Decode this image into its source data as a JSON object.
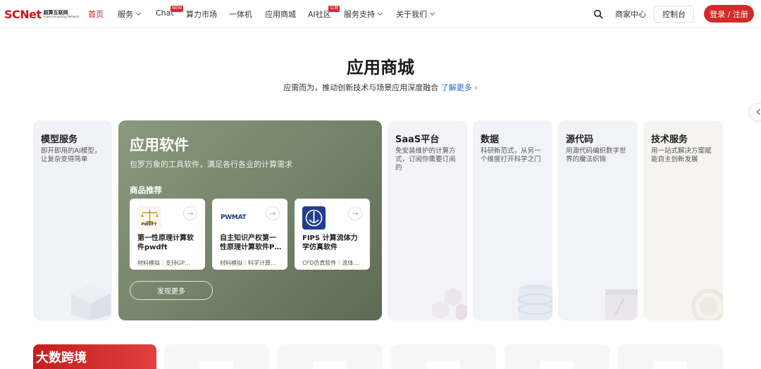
{
  "nav": {
    "logo_main": "SCNet",
    "logo_cn": "超算互联网",
    "logo_en": "Supercomputing Network",
    "items": [
      {
        "label": "首页"
      },
      {
        "label": "服务"
      },
      {
        "label": "Chat",
        "badge": "NEW"
      },
      {
        "label": "算力市场"
      },
      {
        "label": "一体机"
      },
      {
        "label": "应用商城"
      },
      {
        "label": "AI社区",
        "badge": "公测"
      },
      {
        "label": "服务支持"
      },
      {
        "label": "关于我们"
      }
    ],
    "merchant": "商家中心",
    "console": "控制台",
    "login": "登录 / 注册"
  },
  "hero": {
    "title": "应用商城",
    "subtitle": "应需而为，推动创新技术与场景应用深度融合",
    "link": "了解更多"
  },
  "cards": {
    "model": {
      "title": "模型服务",
      "desc": "即开即用的AI模型，让复杂变得简单"
    },
    "featured": {
      "title": "应用软件",
      "desc": "包罗万象的工具软件，满足各行各业的计算需求",
      "recommend": "商品推荐",
      "products": [
        {
          "logo_text": "PWDFT",
          "name": "第一性原理计算软件pwdft",
          "tags": "材料模拟｜支持GP…"
        },
        {
          "logo_text": "PWMAT",
          "name": "自主知识产权第一性原理计算软件P…",
          "tags": "材料模拟｜科学计算…"
        },
        {
          "logo_text": "",
          "name": "FIPS 计算流体力学仿真软件",
          "tags": "CFD仿真软件｜流体…"
        }
      ],
      "more": "发现更多"
    },
    "saas": {
      "title": "SaaS平台",
      "desc": "免安装维护的计算方式，订阅你需要订阅的"
    },
    "data": {
      "title": "数据",
      "desc": "科研新范式，从另一个维度打开科学之门"
    },
    "source": {
      "title": "源代码",
      "desc": "用源代码编织数字世界的魔法织锦"
    },
    "tech": {
      "title": "技术服务",
      "desc": "用一站式解决方案赋能自主创新发展"
    }
  },
  "bottom": {
    "banner": "大数跨境"
  }
}
